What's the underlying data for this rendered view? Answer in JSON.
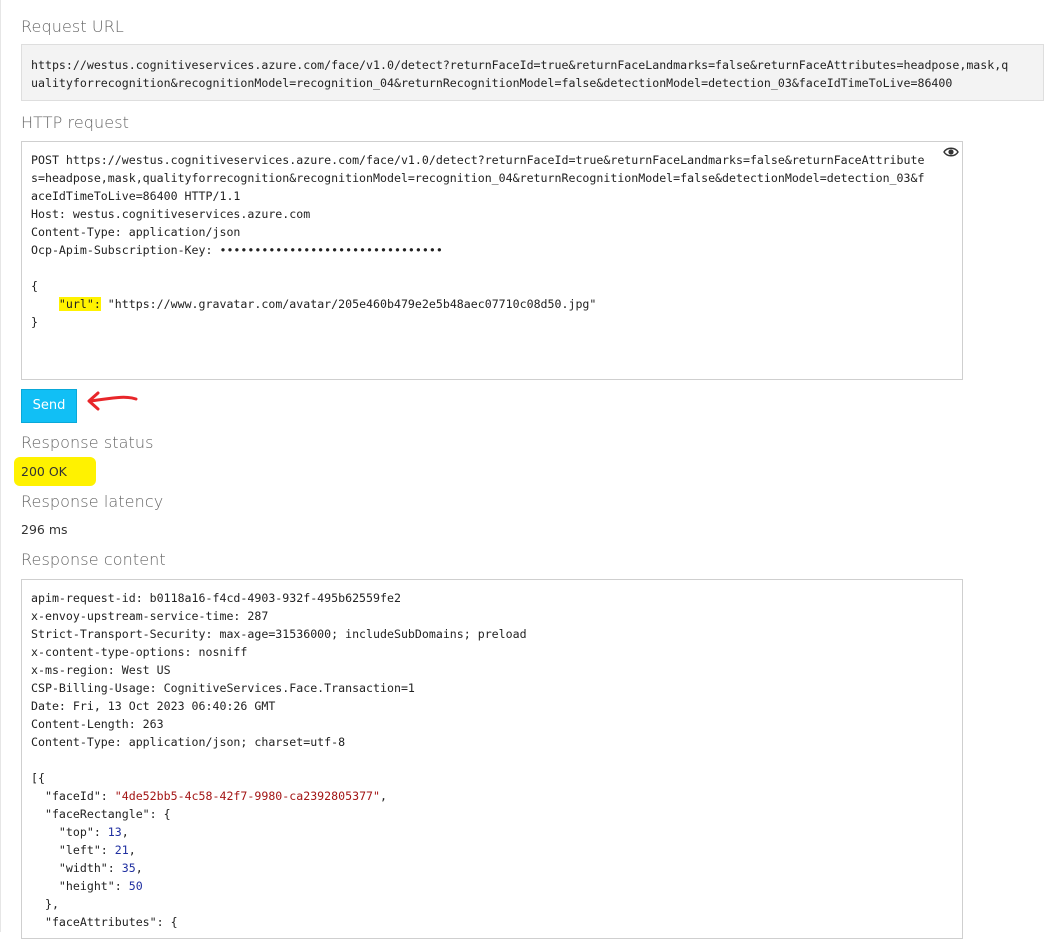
{
  "request_url": {
    "title": "Request URL",
    "line1": "https://westus.cognitiveservices.azure.com/face/v1.0/detect?returnFaceId=true&returnFaceLandmarks=false&returnFaceAttributes=headpose,mask,q",
    "line2": "ualityforrecognition&recognitionModel=recognition_04&returnRecognitionModel=false&detectionModel=detection_03&faceIdTimeToLive=86400"
  },
  "http_request": {
    "title": "HTTP request",
    "line1": "POST https://westus.cognitiveservices.azure.com/face/v1.0/detect?returnFaceId=true&returnFaceLandmarks=false&returnFaceAttribute",
    "line2": "s=headpose,mask,qualityforrecognition&recognitionModel=recognition_04&returnRecognitionModel=false&detectionModel=detection_03&f",
    "line3": "aceIdTimeToLive=86400 HTTP/1.1",
    "host": "Host: westus.cognitiveservices.azure.com",
    "content_type": "Content-Type: application/json",
    "sub_key": "Ocp-Apim-Subscription-Key: ••••••••••••••••••••••••••••••••",
    "brace_open": "{",
    "url_key": "\"url\":",
    "url_value": " \"https://www.gravatar.com/avatar/205e460b479e2e5b48aec07710c08d50.jpg\"",
    "brace_close": "}"
  },
  "send_label": "Send",
  "response_status": {
    "title": "Response status",
    "value": "200 OK"
  },
  "response_latency": {
    "title": "Response latency",
    "value": "296 ms"
  },
  "response_content": {
    "title": "Response content",
    "headers": [
      "apim-request-id: b0118a16-f4cd-4903-932f-495b62559fe2",
      "x-envoy-upstream-service-time: 287",
      "Strict-Transport-Security: max-age=31536000; includeSubDomains; preload",
      "x-content-type-options: nosniff",
      "x-ms-region: West US",
      "CSP-Billing-Usage: CognitiveServices.Face.Transaction=1",
      "Date: Fri, 13 Oct 2023 06:40:26 GMT",
      "Content-Length: 263",
      "Content-Type: application/json; charset=utf-8"
    ],
    "json_open": "[{",
    "face_id_key": "  \"faceId\": ",
    "face_id_val": "\"4de52bb5-4c58-42f7-9980-ca2392805377\"",
    "rect_key": "  \"faceRectangle\": {",
    "top_key": "    \"top\": ",
    "top_val": "13",
    "left_key": "    \"left\": ",
    "left_val": "21",
    "width_key": "    \"width\": ",
    "width_val": "35",
    "height_key": "    \"height\": ",
    "height_val": "50",
    "rect_close": "  },",
    "attr_key": "  \"faceAttributes\": {"
  },
  "colors": {
    "send": "#11bff5",
    "highlight": "#fff200",
    "arrow": "#e8262a",
    "json_string": "#a31515",
    "json_number": "#1f2fa0"
  },
  "icons": [
    "eye-icon",
    "red-arrow-annotation"
  ]
}
